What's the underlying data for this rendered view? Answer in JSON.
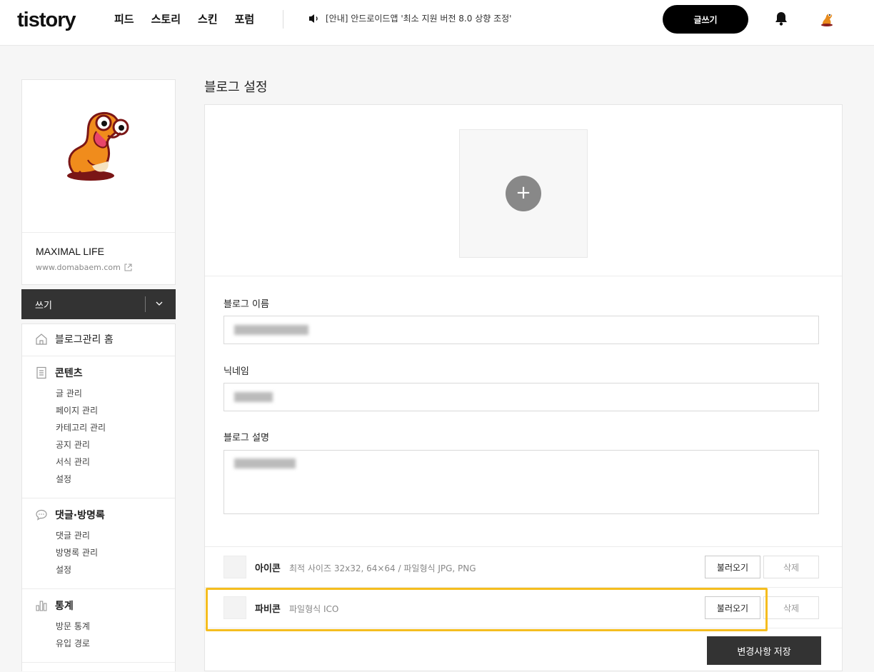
{
  "topbar": {
    "logo": "tistory",
    "nav": [
      "피드",
      "스토리",
      "스킨",
      "포럼"
    ],
    "notice": "[안내] 안드로이드앱 '최소 지원 버전 8.0 상향 조정'",
    "write_button": "글쓰기"
  },
  "sidebar": {
    "blog_title": "MAXIMAL LIFE",
    "blog_url": "www.domabaem.com",
    "write_label": "쓰기",
    "home": "블로그관리 홈",
    "sections": [
      {
        "title": "콘텐츠",
        "icon": "document-icon",
        "items": [
          "글 관리",
          "페이지 관리",
          "카테고리 관리",
          "공지 관리",
          "서식 관리",
          "설정"
        ]
      },
      {
        "title": "댓글·방명록",
        "icon": "speech-bubble-icon",
        "items": [
          "댓글 관리",
          "방명록 관리",
          "설정"
        ]
      },
      {
        "title": "통계",
        "icon": "bar-chart-icon",
        "items": [
          "방문 통계",
          "유입 경로"
        ]
      }
    ]
  },
  "main": {
    "page_title": "블로그 설정",
    "blog_name_label": "블로그 이름",
    "nickname_label": "닉네임",
    "description_label": "블로그 설명",
    "icon_row": {
      "name": "아이콘",
      "desc": "최적 사이즈 32x32, 64×64 / 파일형식 JPG, PNG",
      "load": "불러오기",
      "delete": "삭제"
    },
    "favicon_row": {
      "name": "파비콘",
      "desc": "파일형식 ICO",
      "load": "불러오기",
      "delete": "삭제"
    },
    "save_button": "변경사항 저장"
  },
  "colors": {
    "accent": "#000000",
    "highlight": "#f5bd1f",
    "dark_button": "#333333"
  }
}
